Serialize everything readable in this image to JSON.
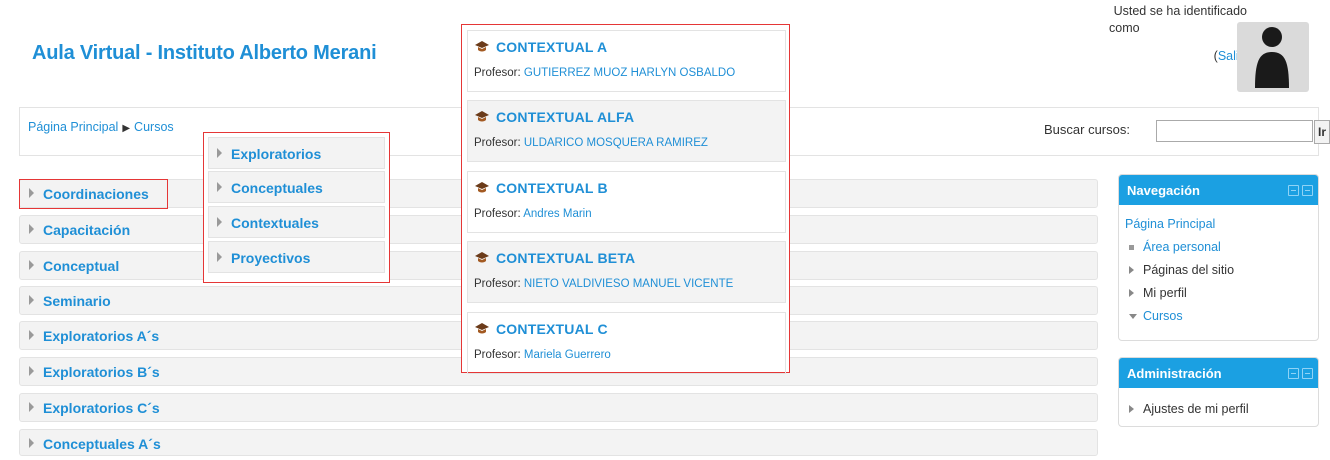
{
  "header": {
    "site_title": "Aula Virtual - Instituto Alberto Merani",
    "login_line1": "Usted se ha identificado",
    "login_line2": "como",
    "logout_label": "Salir"
  },
  "breadcrumb": {
    "home": "Página Principal",
    "current": "Cursos"
  },
  "search": {
    "label": "Buscar cursos:",
    "value": "",
    "button": "Ir"
  },
  "categories": [
    "Coordinaciones",
    "Capacitación",
    "Conceptual",
    "Seminario",
    "Exploratorios A´s",
    "Exploratorios B´s",
    "Exploratorios C´s",
    "Conceptuales A´s"
  ],
  "subcategories": [
    "Exploratorios",
    "Conceptuales",
    "Contextuales",
    "Proyectivos"
  ],
  "courses": [
    {
      "title": "CONTEXTUAL A",
      "teacher_label": "Profesor:",
      "teacher": "GUTIERREZ MUOZ HARLYN OSBALDO"
    },
    {
      "title": "CONTEXTUAL ALFA",
      "teacher_label": "Profesor:",
      "teacher": "ULDARICO MOSQUERA RAMIREZ"
    },
    {
      "title": "CONTEXTUAL B",
      "teacher_label": "Profesor:",
      "teacher": "Andres Marin"
    },
    {
      "title": "CONTEXTUAL BETA",
      "teacher_label": "Profesor:",
      "teacher": "NIETO VALDIVIESO MANUEL VICENTE"
    },
    {
      "title": "CONTEXTUAL C",
      "teacher_label": "Profesor:",
      "teacher": "Mariela Guerrero"
    }
  ],
  "navigation": {
    "title": "Navegación",
    "home": "Página Principal",
    "items": [
      "Área personal",
      "Páginas del sitio",
      "Mi perfil",
      "Cursos"
    ]
  },
  "administration": {
    "title": "Administración",
    "items": [
      "Ajustes de mi perfil"
    ]
  },
  "colors": {
    "link": "#1f8fd6",
    "block_header": "#1ba0e2",
    "highlight_border": "#e53636"
  }
}
